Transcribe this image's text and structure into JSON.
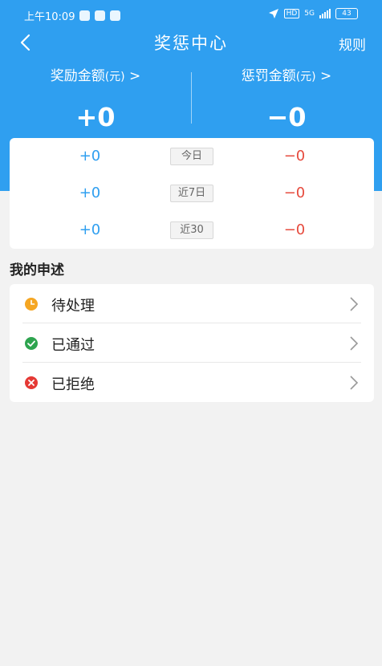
{
  "status_bar": {
    "time": "上午10:09",
    "network": "5G",
    "battery": "43"
  },
  "nav": {
    "title": "奖惩中心",
    "rules_label": "规则"
  },
  "summary": {
    "reward_label": "奖励金额",
    "reward_unit": "(元)",
    "reward_arrow": ">",
    "reward_value": "+0",
    "penalty_label": "惩罚金额",
    "penalty_unit": "(元)",
    "penalty_arrow": ">",
    "penalty_value": "−0"
  },
  "stats": [
    {
      "reward": "+0",
      "period": "今日",
      "penalty": "−0"
    },
    {
      "reward": "+0",
      "period": "近7日",
      "penalty": "−0"
    },
    {
      "reward": "+0",
      "period": "近30",
      "penalty": "−0"
    }
  ],
  "appeals": {
    "title": "我的申述",
    "items": [
      {
        "label": "待处理",
        "icon": "clock-icon",
        "color": "#f5a623"
      },
      {
        "label": "已通过",
        "icon": "check-circle-icon",
        "color": "#2ea44f"
      },
      {
        "label": "已拒绝",
        "icon": "x-circle-icon",
        "color": "#e53935"
      }
    ]
  },
  "colors": {
    "accent": "#2f9ff0",
    "reward": "#2f9ff0",
    "penalty": "#e64a3d"
  }
}
